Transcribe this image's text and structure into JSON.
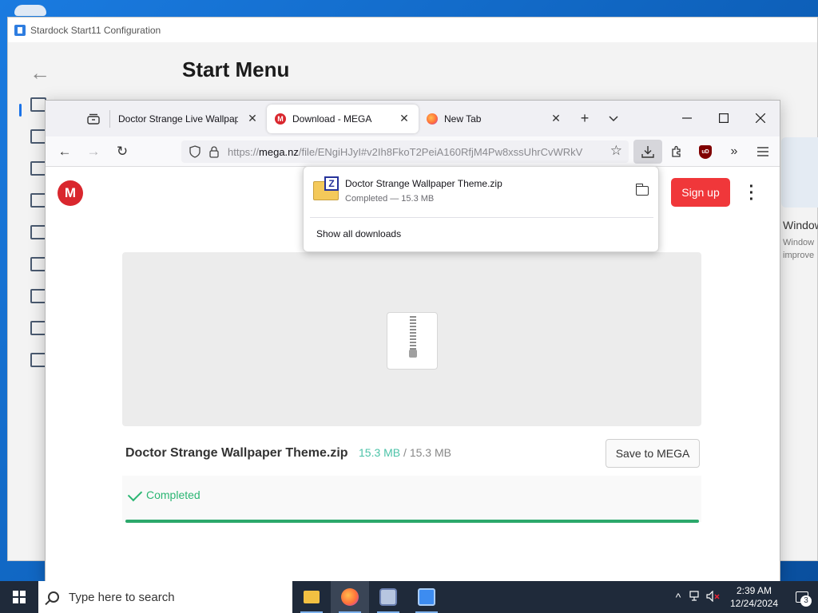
{
  "start11": {
    "title": "Stardock Start11 Configuration",
    "page_title": "Start Menu",
    "right_card_title": "Window",
    "right_card_text_1": "Window",
    "right_card_text_2": "improve"
  },
  "browser": {
    "tabs": [
      {
        "label": "Doctor Strange Live Wallpaper",
        "favicon": "none",
        "active": false
      },
      {
        "label": "Download - MEGA",
        "favicon": "mega-icon",
        "active": true
      },
      {
        "label": "New Tab",
        "favicon": "firefox-icon",
        "active": false
      }
    ],
    "url_prefix": "https://",
    "url_host": "mega.nz",
    "url_path": "/file/ENgiHJyI#v2Ih8FkoT2PeiA160RfjM4Pw8xssUhrCvWRkV",
    "ublock_label": "uD"
  },
  "downloads_panel": {
    "file_name": "Doctor Strange Wallpaper Theme.zip",
    "status": "Completed — 15.3 MB",
    "zip_letter": "Z",
    "show_all": "Show all downloads"
  },
  "mega": {
    "logo_letter": "M",
    "signup_label": "Sign up",
    "file_name": "Doctor Strange Wallpaper Theme.zip",
    "downloaded": "15.3 MB",
    "separator": "/",
    "total": "15.3 MB",
    "save_label": "Save to MEGA",
    "status": "Completed",
    "progress": 1.0
  },
  "taskbar": {
    "search_placeholder": "Type here to search",
    "time": "2:39 AM",
    "date": "12/24/2024",
    "notification_count": "3"
  },
  "colors": {
    "mega_red": "#d9272e",
    "signup_red": "#f0373a",
    "progress_green": "#2ba86b",
    "taskbar_bg": "#1f2a3a"
  }
}
